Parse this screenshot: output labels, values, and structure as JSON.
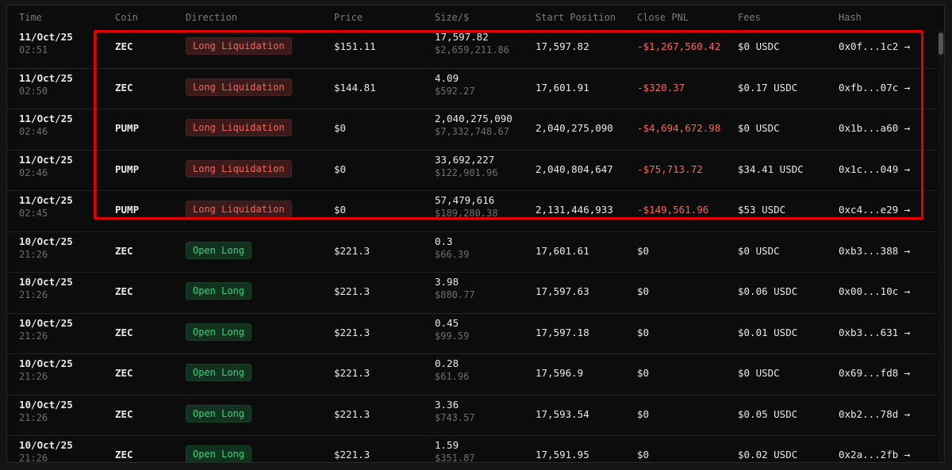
{
  "columns": [
    "Time",
    "Coin",
    "Direction",
    "Price",
    "Size/$",
    "Start Position",
    "Close PNL",
    "Fees",
    "Hash"
  ],
  "colors": {
    "negative": "#f2685a",
    "positive": "#3ecf7a",
    "highlight_box": "#e30000"
  },
  "rows": [
    {
      "date": "11/Oct/25",
      "time": "02:51",
      "coin": "ZEC",
      "direction": "Long Liquidation",
      "direction_type": "liq",
      "price": "$151.11",
      "size": "17,597.82",
      "size_usd": "$2,659,211.86",
      "start_position": "17,597.82",
      "close_pnl": "-$1,267,560.42",
      "pnl_negative": true,
      "fees": "$0 USDC",
      "hash": "0x0f...1c2 →"
    },
    {
      "date": "11/Oct/25",
      "time": "02:50",
      "coin": "ZEC",
      "direction": "Long Liquidation",
      "direction_type": "liq",
      "price": "$144.81",
      "size": "4.09",
      "size_usd": "$592.27",
      "start_position": "17,601.91",
      "close_pnl": "-$320.37",
      "pnl_negative": true,
      "fees": "$0.17 USDC",
      "hash": "0xfb...07c →"
    },
    {
      "date": "11/Oct/25",
      "time": "02:46",
      "coin": "PUMP",
      "direction": "Long Liquidation",
      "direction_type": "liq",
      "price": "$0",
      "size": "2,040,275,090",
      "size_usd": "$7,332,748.67",
      "start_position": "2,040,275,090",
      "close_pnl": "-$4,694,672.98",
      "pnl_negative": true,
      "fees": "$0 USDC",
      "hash": "0x1b...a60 →"
    },
    {
      "date": "11/Oct/25",
      "time": "02:46",
      "coin": "PUMP",
      "direction": "Long Liquidation",
      "direction_type": "liq",
      "price": "$0",
      "size": "33,692,227",
      "size_usd": "$122,901.96",
      "start_position": "2,040,804,647",
      "close_pnl": "-$75,713.72",
      "pnl_negative": true,
      "fees": "$34.41 USDC",
      "hash": "0x1c...049 →"
    },
    {
      "date": "11/Oct/25",
      "time": "02:45",
      "coin": "PUMP",
      "direction": "Long Liquidation",
      "direction_type": "liq",
      "price": "$0",
      "size": "57,479,616",
      "size_usd": "$189,280.38",
      "start_position": "2,131,446,933",
      "close_pnl": "-$149,561.96",
      "pnl_negative": true,
      "fees": "$53 USDC",
      "hash": "0xc4...e29 →"
    },
    {
      "date": "10/Oct/25",
      "time": "21:26",
      "coin": "ZEC",
      "direction": "Open Long",
      "direction_type": "open",
      "price": "$221.3",
      "size": "0.3",
      "size_usd": "$66.39",
      "start_position": "17,601.61",
      "close_pnl": "$0",
      "pnl_negative": false,
      "fees": "$0 USDC",
      "hash": "0xb3...388 →"
    },
    {
      "date": "10/Oct/25",
      "time": "21:26",
      "coin": "ZEC",
      "direction": "Open Long",
      "direction_type": "open",
      "price": "$221.3",
      "size": "3.98",
      "size_usd": "$880.77",
      "start_position": "17,597.63",
      "close_pnl": "$0",
      "pnl_negative": false,
      "fees": "$0.06 USDC",
      "hash": "0x00...10c →"
    },
    {
      "date": "10/Oct/25",
      "time": "21:26",
      "coin": "ZEC",
      "direction": "Open Long",
      "direction_type": "open",
      "price": "$221.3",
      "size": "0.45",
      "size_usd": "$99.59",
      "start_position": "17,597.18",
      "close_pnl": "$0",
      "pnl_negative": false,
      "fees": "$0.01 USDC",
      "hash": "0xb3...631 →"
    },
    {
      "date": "10/Oct/25",
      "time": "21:26",
      "coin": "ZEC",
      "direction": "Open Long",
      "direction_type": "open",
      "price": "$221.3",
      "size": "0.28",
      "size_usd": "$61.96",
      "start_position": "17,596.9",
      "close_pnl": "$0",
      "pnl_negative": false,
      "fees": "$0 USDC",
      "hash": "0x69...fd8 →"
    },
    {
      "date": "10/Oct/25",
      "time": "21:26",
      "coin": "ZEC",
      "direction": "Open Long",
      "direction_type": "open",
      "price": "$221.3",
      "size": "3.36",
      "size_usd": "$743.57",
      "start_position": "17,593.54",
      "close_pnl": "$0",
      "pnl_negative": false,
      "fees": "$0.05 USDC",
      "hash": "0xb2...78d →"
    },
    {
      "date": "10/Oct/25",
      "time": "21:26",
      "coin": "ZEC",
      "direction": "Open Long",
      "direction_type": "open",
      "price": "$221.3",
      "size": "1.59",
      "size_usd": "$351.87",
      "start_position": "17,591.95",
      "close_pnl": "$0",
      "pnl_negative": false,
      "fees": "$0.02 USDC",
      "hash": "0x2a...2fb →"
    }
  ]
}
